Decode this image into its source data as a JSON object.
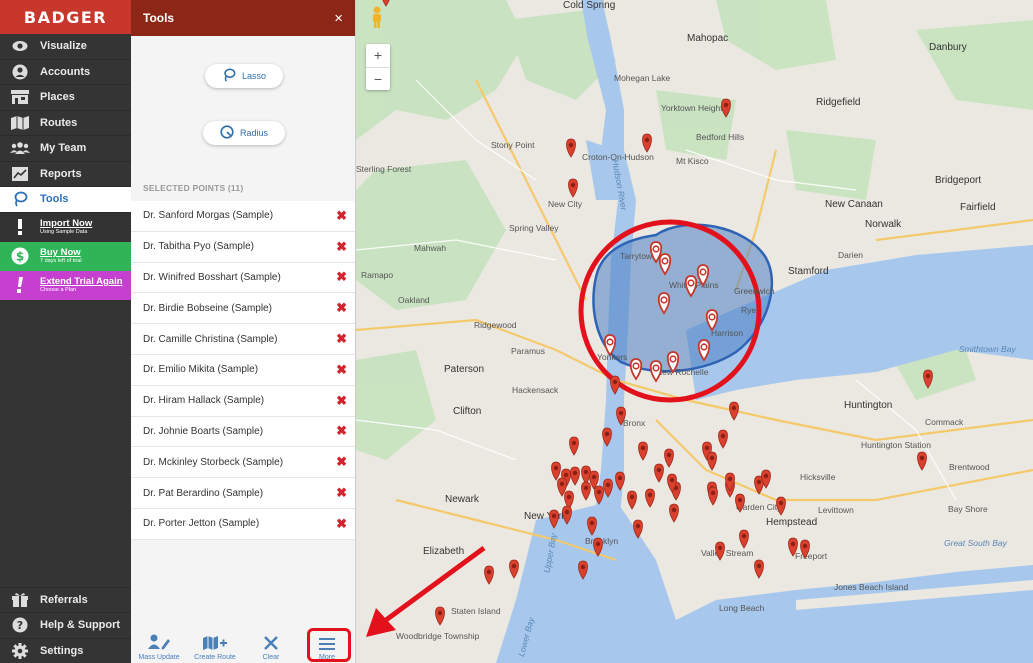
{
  "sidebar": {
    "logo": "BADGER",
    "items": [
      {
        "label": "Visualize",
        "icon": "eye-icon"
      },
      {
        "label": "Accounts",
        "icon": "person-icon"
      },
      {
        "label": "Places",
        "icon": "building-icon"
      },
      {
        "label": "Routes",
        "icon": "map-icon"
      },
      {
        "label": "My Team",
        "icon": "team-icon"
      },
      {
        "label": "Reports",
        "icon": "chart-icon"
      },
      {
        "label": "Tools",
        "icon": "lasso-icon"
      }
    ],
    "promos": {
      "import": {
        "title": "Import Now",
        "subtitle": "Using Sample Data"
      },
      "buy": {
        "title": "Buy Now",
        "subtitle": "7 days left of trial"
      },
      "extend": {
        "title": "Extend Trial Again",
        "subtitle": "Choose a Plan"
      }
    },
    "bottom": [
      {
        "label": "Referrals",
        "icon": "gift-icon"
      },
      {
        "label": "Help & Support",
        "icon": "help-icon"
      },
      {
        "label": "Settings",
        "icon": "gear-icon"
      }
    ]
  },
  "tools": {
    "title": "Tools",
    "close": "×",
    "lasso": "Lasso",
    "radius": "Radius",
    "selected_title": "SELECTED POINTS (11)",
    "points": [
      "Dr. Sanford Morgas (Sample)",
      "Dr. Tabitha Pyo (Sample)",
      "Dr. Winifred Bosshart (Sample)",
      "Dr. Birdie Bobseine (Sample)",
      "Dr. Camille Christina (Sample)",
      "Dr. Emilio Mikita (Sample)",
      "Dr. Hiram Hallack (Sample)",
      "Dr. Johnie Boarts (Sample)",
      "Dr. Mckinley Storbeck (Sample)",
      "Dr. Pat Berardino (Sample)",
      "Dr. Porter Jetton (Sample)"
    ],
    "footer": {
      "mass_update": "Mass Update",
      "create_route": "Create Route",
      "clear": "Clear",
      "more": "More"
    }
  },
  "map": {
    "zoom_in": "+",
    "zoom_out": "−",
    "labels": [
      "Cold Spring",
      "Mahopac",
      "Mohegan Lake",
      "Yorktown Heights",
      "Bedford Hills",
      "Ridgefield",
      "Croton-On-Hudson",
      "Mt Kisco",
      "Danbury",
      "Stony Point",
      "Sterling Forest",
      "New City",
      "New Canaan",
      "Norwalk",
      "Bridgeport",
      "Fairfield",
      "Spring Valley",
      "Tarrytown",
      "Whitte Plains",
      "Stamford",
      "Greenwich",
      "Darien",
      "Oakland",
      "Mahwah",
      "Ridgewood",
      "Paramus",
      "Paterson",
      "Yonkers",
      "New Rochelle",
      "Harrison",
      "Hackensack",
      "Clifton",
      "Huntington",
      "Commack",
      "Smithtown Bay",
      "Hicksville",
      "Brentwood",
      "Newark",
      "New York",
      "Garden City",
      "Hempstead",
      "Levittown",
      "Bay Shore",
      "Elizabeth",
      "Brooklyn",
      "Valley Stream",
      "Freeport",
      "Great South Bay",
      "Jones Beach Island",
      "Long Beach",
      "Staten Island",
      "Upper Bay",
      "Lower Bay",
      "Hudson River",
      "Bronx",
      "Ramapo",
      "Rye",
      "Huntington Station",
      "Woodbridge Township"
    ]
  },
  "colors": {
    "brand_red": "#c8372c",
    "header_red": "#8c2718",
    "active_blue": "#2c72b8",
    "buy_green": "#2fb457",
    "extend_magenta": "#c640cf",
    "pin_red": "#d9402d",
    "annotation_red": "#e2111b"
  }
}
